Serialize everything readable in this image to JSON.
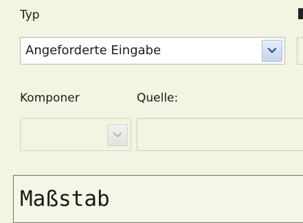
{
  "typ_section": {
    "label": "Typ",
    "combo_value": "Angeforderte Eingabe",
    "chevron_icon": "chevron-down-icon"
  },
  "komponente_section": {
    "label": "Komponer",
    "combo_value": ""
  },
  "quelle_section": {
    "label": "Quelle:",
    "value": ""
  },
  "main_field": {
    "value": "Maßstab"
  },
  "colors": {
    "background": "#f4f4e2",
    "dropdown_button": "#c4d6ee",
    "chevron": "#3a5a96"
  }
}
